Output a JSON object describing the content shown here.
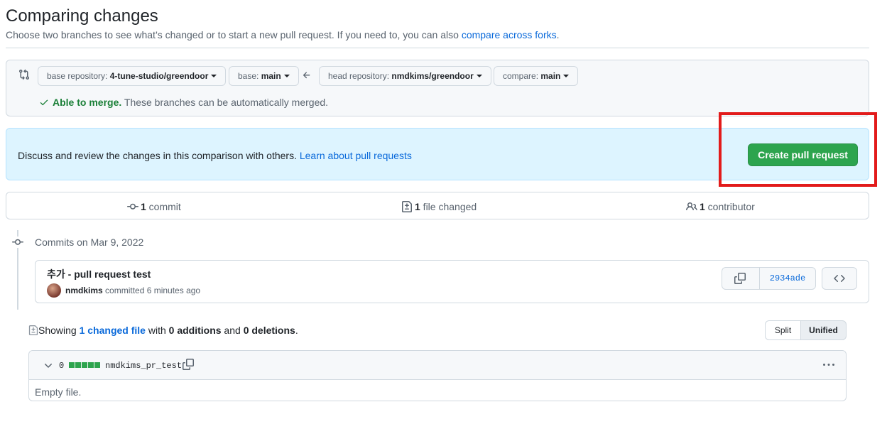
{
  "header": {
    "title": "Comparing changes",
    "subtitle": "Choose two branches to see what’s changed or to start a new pull request. If you need to, you can also ",
    "subtitle_link": "compare across forks",
    "subtitle_end": "."
  },
  "range": {
    "base_repo_label": "base repository: ",
    "base_repo_value": "4-tune-studio/greendoor",
    "base_label": "base: ",
    "base_value": "main",
    "head_repo_label": "head repository: ",
    "head_repo_value": "nmdkims/greendoor",
    "compare_label": "compare: ",
    "compare_value": "main",
    "merge_status": "Able to merge.",
    "merge_detail": " These branches can be automatically merged."
  },
  "flash": {
    "text": "Discuss and review the changes in this comparison with others. ",
    "link": "Learn about pull requests",
    "button": "Create pull request"
  },
  "stats": {
    "commits_count": "1",
    "commits_label": " commit",
    "files_count": "1",
    "files_label": " file changed",
    "contributors_count": "1",
    "contributors_label": " contributor"
  },
  "timeline": {
    "date_label": "Commits on Mar 9, 2022"
  },
  "commit": {
    "message": "추가 - pull request test",
    "author": "nmdkims",
    "action": " committed 6 minutes ago",
    "sha": "2934ade"
  },
  "summary": {
    "prefix": "Showing ",
    "link": "1 changed file",
    "mid1": " with ",
    "additions": "0 additions",
    "mid2": " and ",
    "deletions": "0 deletions",
    "end": "."
  },
  "view_toggle": {
    "split": "Split",
    "unified": "Unified",
    "selected": "Unified"
  },
  "file": {
    "changes": "0",
    "name": "nmdkims_pr_test",
    "body": "Empty file."
  },
  "colors": {
    "accent": "#0969da",
    "success": "#2da44e",
    "flash_bg": "#ddf4ff",
    "highlight": "#e21b1b"
  }
}
